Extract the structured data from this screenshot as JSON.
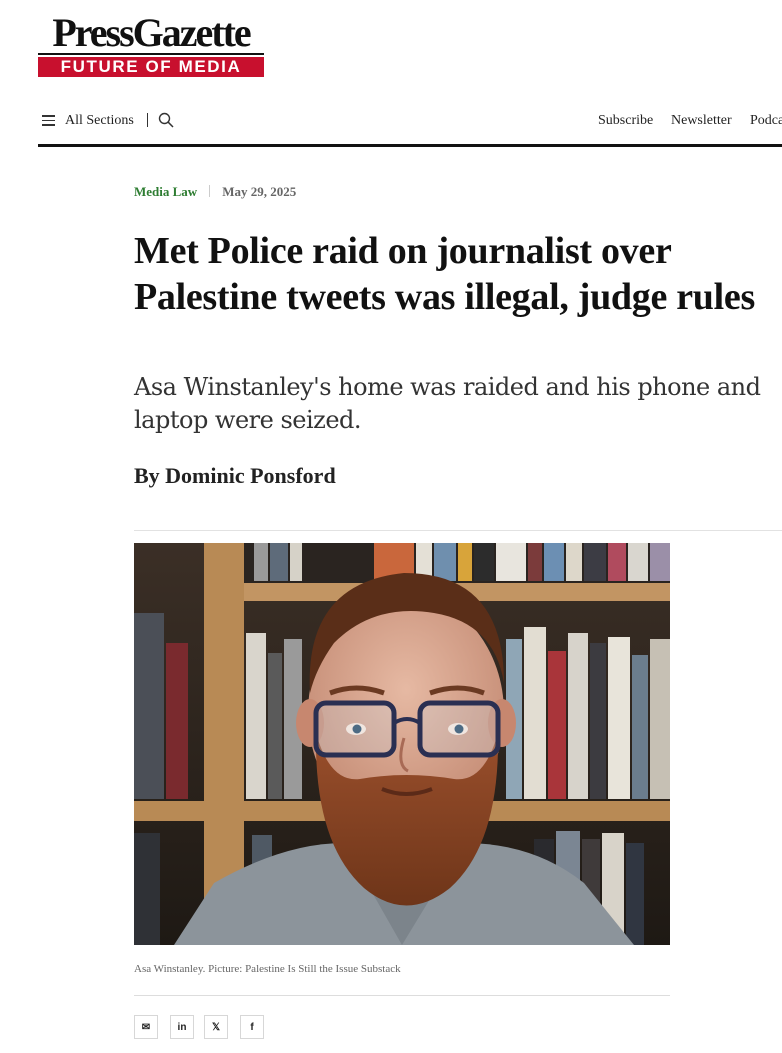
{
  "logo": {
    "wordmark": "PressGazette",
    "tagline": "FUTURE OF MEDIA",
    "brand_red": "#c8102e"
  },
  "nav": {
    "sections_label": "All Sections",
    "menu_icon": "hamburger-icon",
    "search_icon": "search-icon",
    "links": [
      "Subscribe",
      "Newsletter",
      "Podca"
    ]
  },
  "article": {
    "category": "Media Law",
    "date": "May 29, 2025",
    "headline": "Met Police raid on journalist over Palestine tweets was illegal, judge rules",
    "standfirst": "Asa Winstanley's home was raided and his phone and laptop were seized.",
    "byline": "By Dominic Ponsford",
    "image_caption": "Asa Winstanley. Picture: Palestine Is Still the Issue Substack",
    "category_color": "#2e7d32"
  },
  "share": {
    "buttons": [
      {
        "icon": "email-icon",
        "label": "✉"
      },
      {
        "icon": "linkedin-icon",
        "label": "in"
      },
      {
        "icon": "x-icon",
        "label": "𝕏"
      },
      {
        "icon": "facebook-icon",
        "label": "f"
      }
    ]
  }
}
